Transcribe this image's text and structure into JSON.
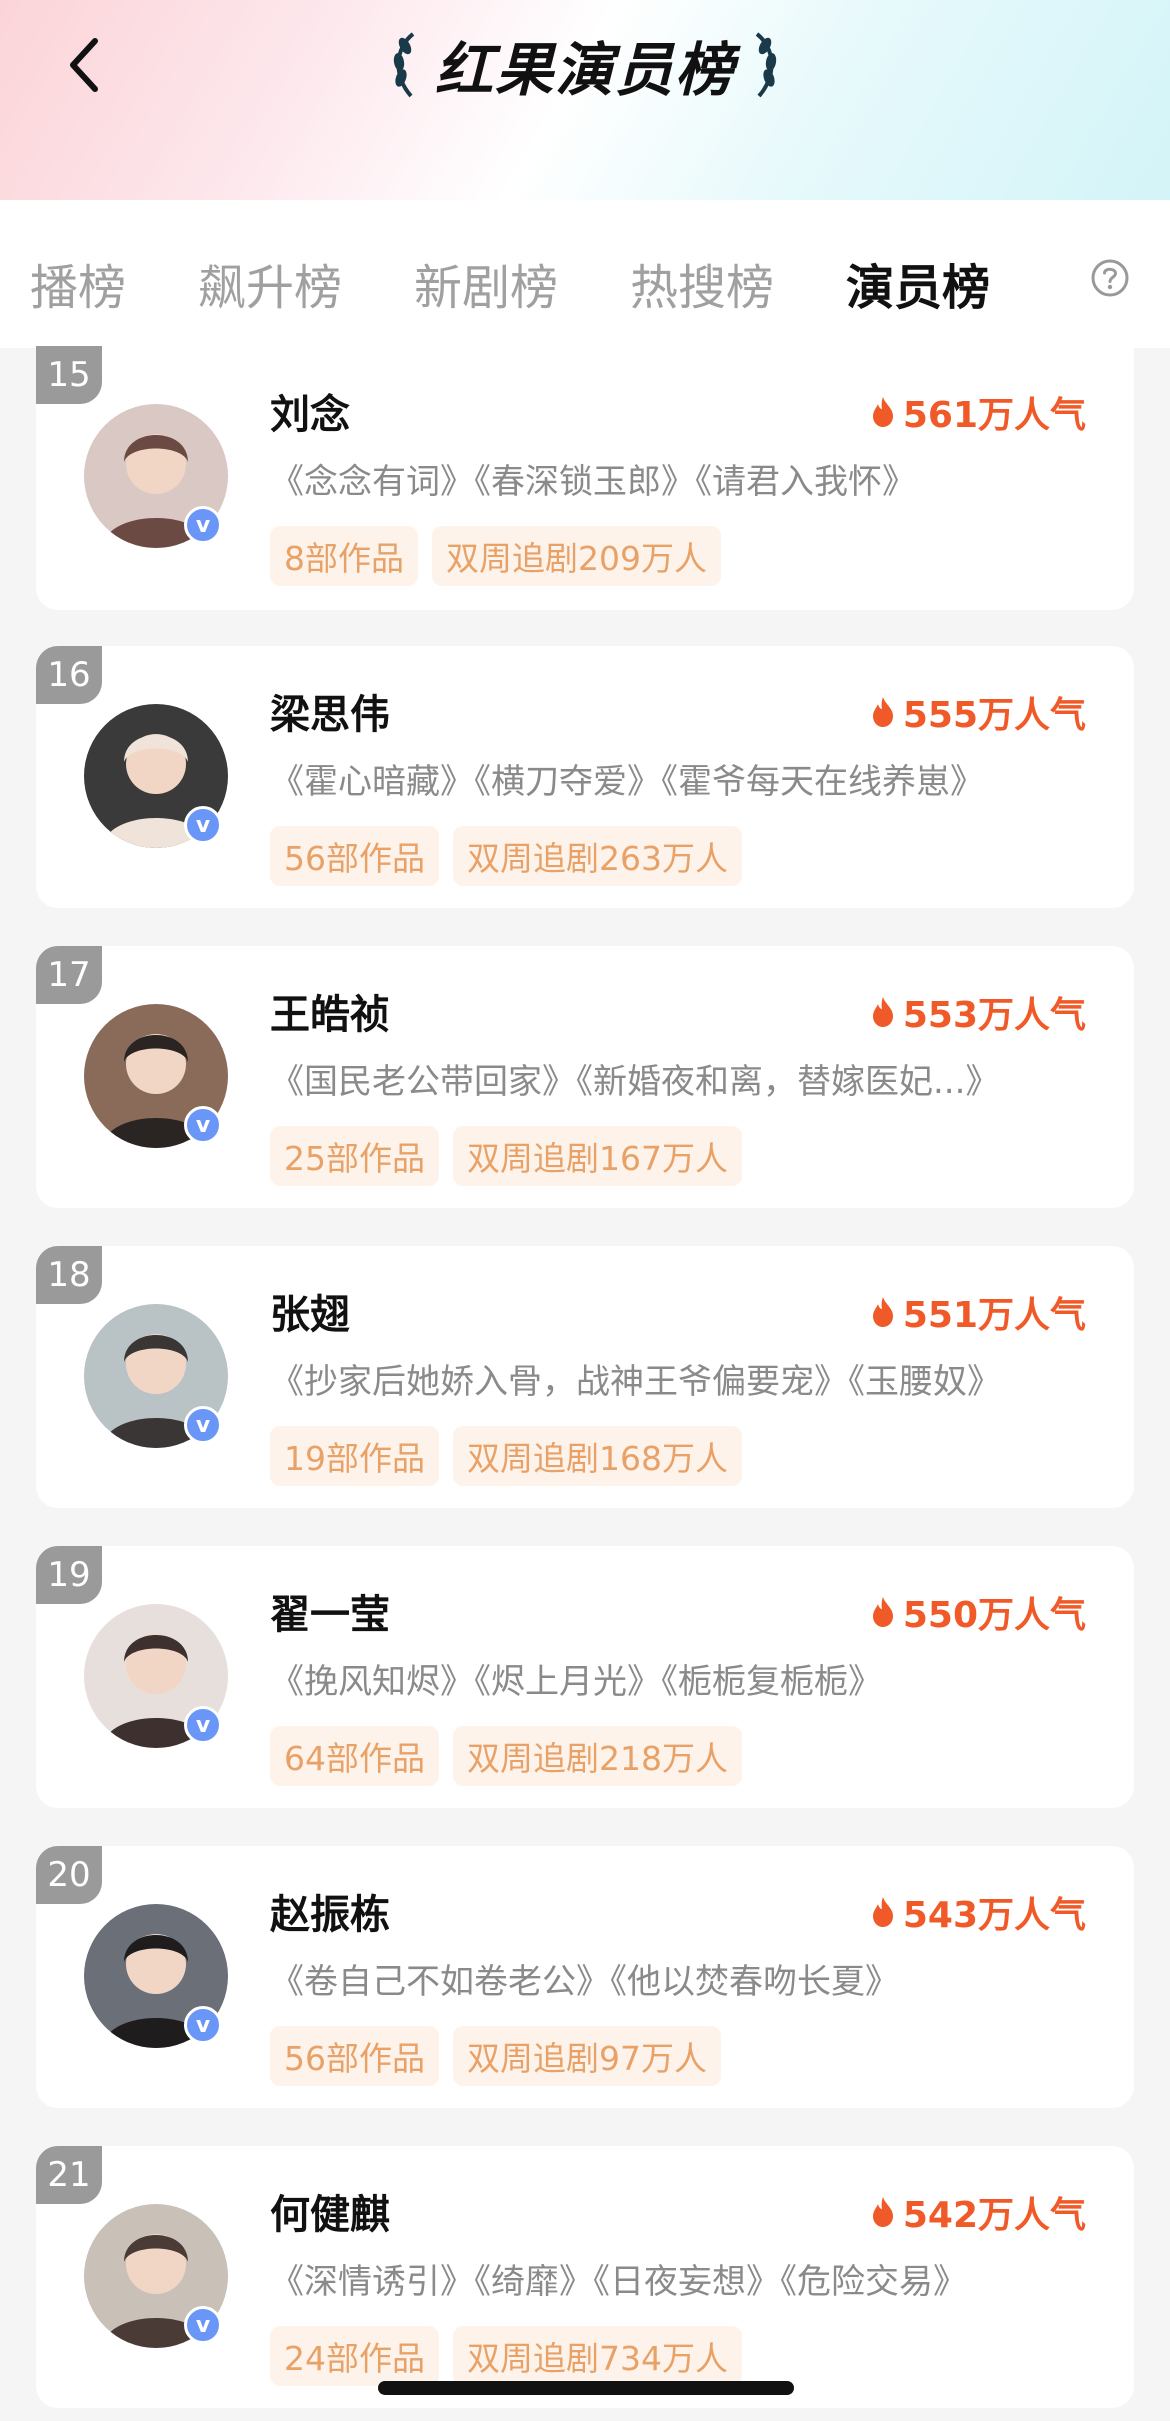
{
  "header": {
    "title": "红果演员榜",
    "colors": {
      "accent": "#f05a28",
      "tag_bg": "#fdf3ea",
      "tag_text": "#e8a268",
      "rank_bg": "#9a9a9a",
      "verified": "#6a96f8"
    }
  },
  "tabs": [
    {
      "label": "播榜",
      "active": false
    },
    {
      "label": "飙升榜",
      "active": false
    },
    {
      "label": "新剧榜",
      "active": false
    },
    {
      "label": "热搜榜",
      "active": false
    },
    {
      "label": "演员榜",
      "active": true
    }
  ],
  "actors": [
    {
      "rank": "15",
      "name": "刘念",
      "popularity": "561万人气",
      "works": "《念念有词》《春深锁玉郎》《请君入我怀》",
      "work_count": "8部作品",
      "followers": "双周追剧209万人"
    },
    {
      "rank": "16",
      "name": "梁思伟",
      "popularity": "555万人气",
      "works": "《霍心暗藏》《横刀夺爱》《霍爷每天在线养崽》",
      "work_count": "56部作品",
      "followers": "双周追剧263万人"
    },
    {
      "rank": "17",
      "name": "王皓祯",
      "popularity": "553万人气",
      "works": "《国民老公带回家》《新婚夜和离，替嫁医妃...》",
      "work_count": "25部作品",
      "followers": "双周追剧167万人"
    },
    {
      "rank": "18",
      "name": "张翅",
      "popularity": "551万人气",
      "works": "《抄家后她娇入骨，战神王爷偏要宠》《玉腰奴》",
      "work_count": "19部作品",
      "followers": "双周追剧168万人"
    },
    {
      "rank": "19",
      "name": "翟一莹",
      "popularity": "550万人气",
      "works": "《挽风知烬》《烬上月光》《栀栀复栀栀》",
      "work_count": "64部作品",
      "followers": "双周追剧218万人"
    },
    {
      "rank": "20",
      "name": "赵振栋",
      "popularity": "543万人气",
      "works": "《卷自己不如卷老公》《他以焚春吻长夏》",
      "work_count": "56部作品",
      "followers": "双周追剧97万人"
    },
    {
      "rank": "21",
      "name": "何健麒",
      "popularity": "542万人气",
      "works": "《深情诱引》《绮靡》《日夜妄想》《危险交易》",
      "work_count": "24部作品",
      "followers": "双周追剧734万人"
    }
  ]
}
